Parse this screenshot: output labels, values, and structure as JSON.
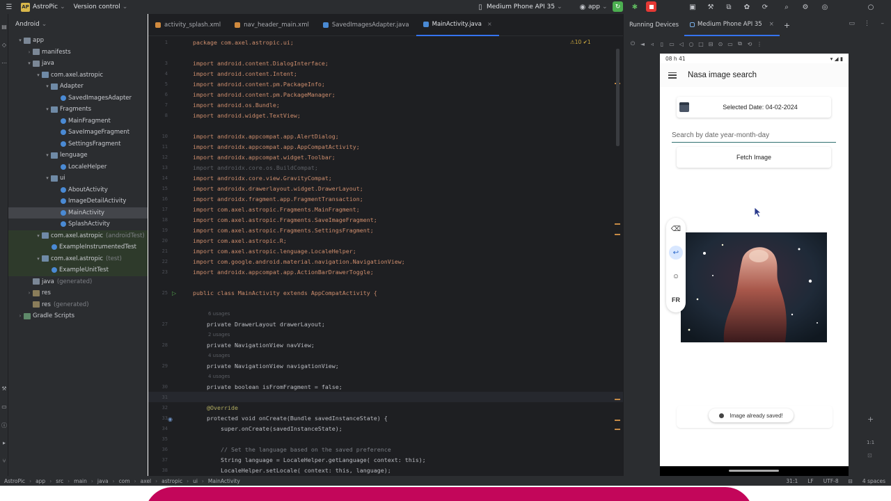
{
  "topbar": {
    "project_badge": "AP",
    "project_name": "AstroPic",
    "vcs": "Version control",
    "device": "Medium Phone API 35",
    "run_config": "app"
  },
  "project_panel": {
    "view": "Android",
    "tree": [
      {
        "label": "app",
        "indent": 0,
        "icon": "folder",
        "chev": "▾"
      },
      {
        "label": "manifests",
        "indent": 1,
        "icon": "folder",
        "chev": "›"
      },
      {
        "label": "java",
        "indent": 1,
        "icon": "folder",
        "chev": "▾"
      },
      {
        "label": "com.axel.astropic",
        "indent": 2,
        "icon": "pkg",
        "chev": "▾"
      },
      {
        "label": "Adapter",
        "indent": 3,
        "icon": "pkg",
        "chev": "▾"
      },
      {
        "label": "SavedImagesAdapter",
        "indent": 4,
        "icon": "cls",
        "chev": ""
      },
      {
        "label": "Fragments",
        "indent": 3,
        "icon": "pkg",
        "chev": "▾"
      },
      {
        "label": "MainFragment",
        "indent": 4,
        "icon": "cls",
        "chev": ""
      },
      {
        "label": "SaveImageFragment",
        "indent": 4,
        "icon": "cls",
        "chev": ""
      },
      {
        "label": "SettingsFragment",
        "indent": 4,
        "icon": "cls",
        "chev": ""
      },
      {
        "label": "lenguage",
        "indent": 3,
        "icon": "pkg",
        "chev": "▾"
      },
      {
        "label": "LocaleHelper",
        "indent": 4,
        "icon": "cls",
        "chev": ""
      },
      {
        "label": "ui",
        "indent": 3,
        "icon": "pkg",
        "chev": "▾"
      },
      {
        "label": "AboutActivity",
        "indent": 4,
        "icon": "cls",
        "chev": ""
      },
      {
        "label": "ImageDetailActivity",
        "indent": 4,
        "icon": "cls",
        "chev": ""
      },
      {
        "label": "MainActivity",
        "indent": 4,
        "icon": "cls",
        "chev": "",
        "selected": true
      },
      {
        "label": "SplashActivity",
        "indent": 4,
        "icon": "cls",
        "chev": ""
      },
      {
        "label": "com.axel.astropic",
        "suffix": "(androidTest)",
        "indent": 2,
        "icon": "pkg",
        "chev": "▾",
        "test": true
      },
      {
        "label": "ExampleInstrumentedTest",
        "indent": 3,
        "icon": "cls",
        "chev": "",
        "test": true
      },
      {
        "label": "com.axel.astropic",
        "suffix": "(test)",
        "indent": 2,
        "icon": "pkg",
        "chev": "▾",
        "test": true
      },
      {
        "label": "ExampleUnitTest",
        "indent": 3,
        "icon": "cls",
        "chev": "",
        "test": true
      },
      {
        "label": "java",
        "suffix": "(generated)",
        "indent": 1,
        "icon": "folder",
        "chev": ""
      },
      {
        "label": "res",
        "indent": 1,
        "icon": "res",
        "chev": "›"
      },
      {
        "label": "res",
        "suffix": "(generated)",
        "indent": 1,
        "icon": "res",
        "chev": ""
      },
      {
        "label": "Gradle Scripts",
        "indent": 0,
        "icon": "gradle",
        "chev": "›"
      }
    ]
  },
  "editor": {
    "tabs": [
      {
        "label": "activity_splash.xml",
        "color": "#d08a3e",
        "active": false
      },
      {
        "label": "nav_header_main.xml",
        "color": "#d08a3e",
        "active": false
      },
      {
        "label": "SavedImagesAdapter.java",
        "color": "#4a8ad4",
        "active": false
      },
      {
        "label": "MainActivity.java",
        "color": "#4a8ad4",
        "active": true
      }
    ],
    "inspections": "⚠10 ✔1",
    "lines": [
      {
        "n": "1",
        "t": "package com.axel.astropic.ui;"
      },
      {
        "n": "",
        "t": ""
      },
      {
        "n": "3",
        "t": "import android.content.DialogInterface;"
      },
      {
        "n": "4",
        "t": "import android.content.Intent;"
      },
      {
        "n": "5",
        "t": "import android.content.pm.PackageInfo;"
      },
      {
        "n": "6",
        "t": "import android.content.pm.PackageManager;"
      },
      {
        "n": "7",
        "t": "import android.os.Bundle;"
      },
      {
        "n": "8",
        "t": "import android.widget.TextView;"
      },
      {
        "n": "",
        "t": ""
      },
      {
        "n": "10",
        "t": "import androidx.appcompat.app.AlertDialog;"
      },
      {
        "n": "11",
        "t": "import androidx.appcompat.app.AppCompatActivity;"
      },
      {
        "n": "12",
        "t": "import androidx.appcompat.widget.Toolbar;"
      },
      {
        "n": "13",
        "t": "import androidx.core.os.BuildCompat;",
        "dim": true
      },
      {
        "n": "14",
        "t": "import androidx.core.view.GravityCompat;"
      },
      {
        "n": "15",
        "t": "import androidx.drawerlayout.widget.DrawerLayout;"
      },
      {
        "n": "16",
        "t": "import androidx.fragment.app.FragmentTransaction;"
      },
      {
        "n": "17",
        "t": "import com.axel.astropic.Fragments.MainFragment;"
      },
      {
        "n": "18",
        "t": "import com.axel.astropic.Fragments.SaveImageFragment;"
      },
      {
        "n": "19",
        "t": "import com.axel.astropic.Fragments.SettingsFragment;"
      },
      {
        "n": "20",
        "t": "import com.axel.astropic.R;"
      },
      {
        "n": "21",
        "t": "import com.axel.astropic.lenguage.LocaleHelper;"
      },
      {
        "n": "22",
        "t": "import com.google.android.material.navigation.NavigationView;"
      },
      {
        "n": "23",
        "t": "import androidx.appcompat.app.ActionBarDrawerToggle;"
      },
      {
        "n": "",
        "t": ""
      },
      {
        "n": "25",
        "t": "public class MainActivity extends AppCompatActivity {"
      },
      {
        "n": "",
        "t": ""
      },
      {
        "n": "",
        "t": "",
        "usage": "6 usages"
      },
      {
        "n": "27",
        "t": "    private DrawerLayout drawerLayout;"
      },
      {
        "n": "",
        "t": "",
        "usage": "2 usages"
      },
      {
        "n": "28",
        "t": "    private NavigationView navView;"
      },
      {
        "n": "",
        "t": "",
        "usage": "4 usages"
      },
      {
        "n": "29",
        "t": "    private NavigationView navigationView;"
      },
      {
        "n": "",
        "t": "",
        "usage": "4 usages"
      },
      {
        "n": "30",
        "t": "    private boolean isFromFragment = false;"
      },
      {
        "n": "31",
        "t": "",
        "current": true
      },
      {
        "n": "32",
        "t": "    @Override"
      },
      {
        "n": "33",
        "t": "    protected void onCreate(Bundle savedInstanceState) {"
      },
      {
        "n": "34",
        "t": "        super.onCreate(savedInstanceState);"
      },
      {
        "n": "35",
        "t": ""
      },
      {
        "n": "36",
        "t": "        // Set the language based on the saved preference"
      },
      {
        "n": "37",
        "t": "        String language = LocaleHelper.getLanguage( context: this);"
      },
      {
        "n": "38",
        "t": "        LocaleHelper.setLocale( context: this, language);"
      }
    ]
  },
  "devices": {
    "tab_running": "Running Devices",
    "tab_device": "Medium Phone API 35"
  },
  "phone": {
    "time": "08 h 41",
    "app_title": "Nasa image search",
    "selected_date": "Selected Date: 04-02-2024",
    "search_placeholder": "Search by date year-month-day",
    "fetch_label": "Fetch Image",
    "toast": "Image already saved!",
    "kbd_lang": "FR"
  },
  "status": {
    "breadcrumbs": [
      "AstroPic",
      "app",
      "src",
      "main",
      "java",
      "com",
      "axel",
      "astropic",
      "ui",
      "MainActivity"
    ],
    "position": "31:1",
    "line_sep": "LF",
    "encoding": "UTF-8",
    "indent": "4 spaces"
  },
  "colors": {
    "accent": "#3574f0",
    "run_green": "#4caf50",
    "stop_red": "#e53935",
    "brand_pink": "#c3065a"
  }
}
